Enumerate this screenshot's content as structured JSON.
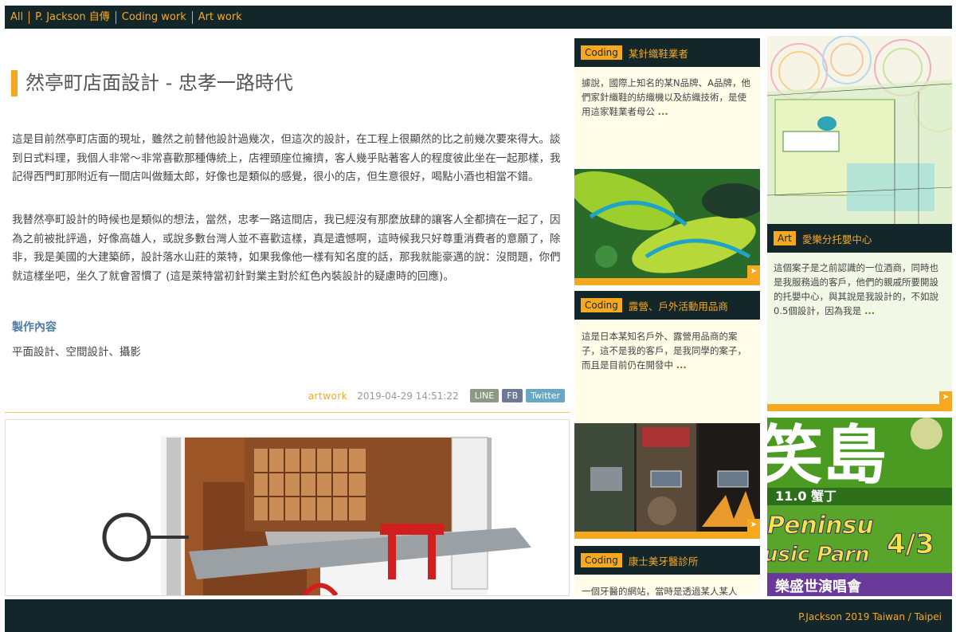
{
  "nav": [
    "All",
    "P. Jackson 自傳",
    "Coding work",
    "Art work"
  ],
  "article": {
    "title": "然亭町店面設計 - 忠孝一路時代",
    "p1": "這是目前然亭町店面的現址，雖然之前替他設計過幾次，但這次的設計，在工程上很顯然的比之前幾次要來得大。談到日式料理，我個人非常〜非常喜歡那種傳統上，店裡頭座位擁擠，客人幾乎貼著客人的程度彼此坐在一起那樣，我記得西門町那附近有一間店叫做麵太郎，好像也是類似的感覺，很小的店，但生意很好，喝點小酒也相當不錯。",
    "p2": "我替然亭町設計的時候也是類似的想法，當然，忠孝一路這間店，我已經沒有那麼放肆的讓客人全都擠在一起了，因為之前被批評過，好像高雄人，或說多數台灣人並不喜歡這樣，真是遺憾啊，這時候我只好尊重消費者的意願了，除非，我是美國的大建築師，設計落水山莊的萊特，如果我像他一樣有知名度的話，那我就能豪邁的說：沒問題，你們就這樣坐吧，坐久了就會習慣了 (這是萊特當初針對業主對於紅色內裝設計的疑慮時的回應)。",
    "subhead": "製作內容",
    "subtext": "平面設計、空間設計、攝影",
    "category": "artwork",
    "date": "2019-04-29 14:51:22",
    "share": [
      "LINE",
      "FB",
      "Twitter"
    ]
  },
  "cards": [
    {
      "tag": "Coding",
      "title": "某針織鞋業者",
      "text": "據說，國際上知名的某N品牌、A品牌，他們家針織鞋的紡織機以及紡織技術，是使用這家鞋業者母公",
      "more": "..."
    },
    {
      "tag": "Coding",
      "title": "露營、戶外活動用品商",
      "text": "這是日本某知名戶外、露營用品商的案子，這不是我的客戶，是我同學的案子，而且是目前仍在開發中",
      "more": "..."
    },
    {
      "tag": "Coding",
      "title": "康士美牙醫診所",
      "text": "一個牙醫的網站，當時是透過某人某人",
      "more": ""
    },
    {
      "tag": "Art",
      "title": "愛樂分托嬰中心",
      "text": "這個案子是之前認識的一位酒商，同時也是我服務過的客戶，他們的親戚所要開設的托嬰中心，與其說是我設計的，不如說0.5個設計，因為我是",
      "more": "..."
    }
  ],
  "footer": "P.Jackson 2019 Taiwan / Taipei",
  "colors": {
    "accent": "#f6a821",
    "dark": "#13272b",
    "card_bg": "#fffde8"
  }
}
